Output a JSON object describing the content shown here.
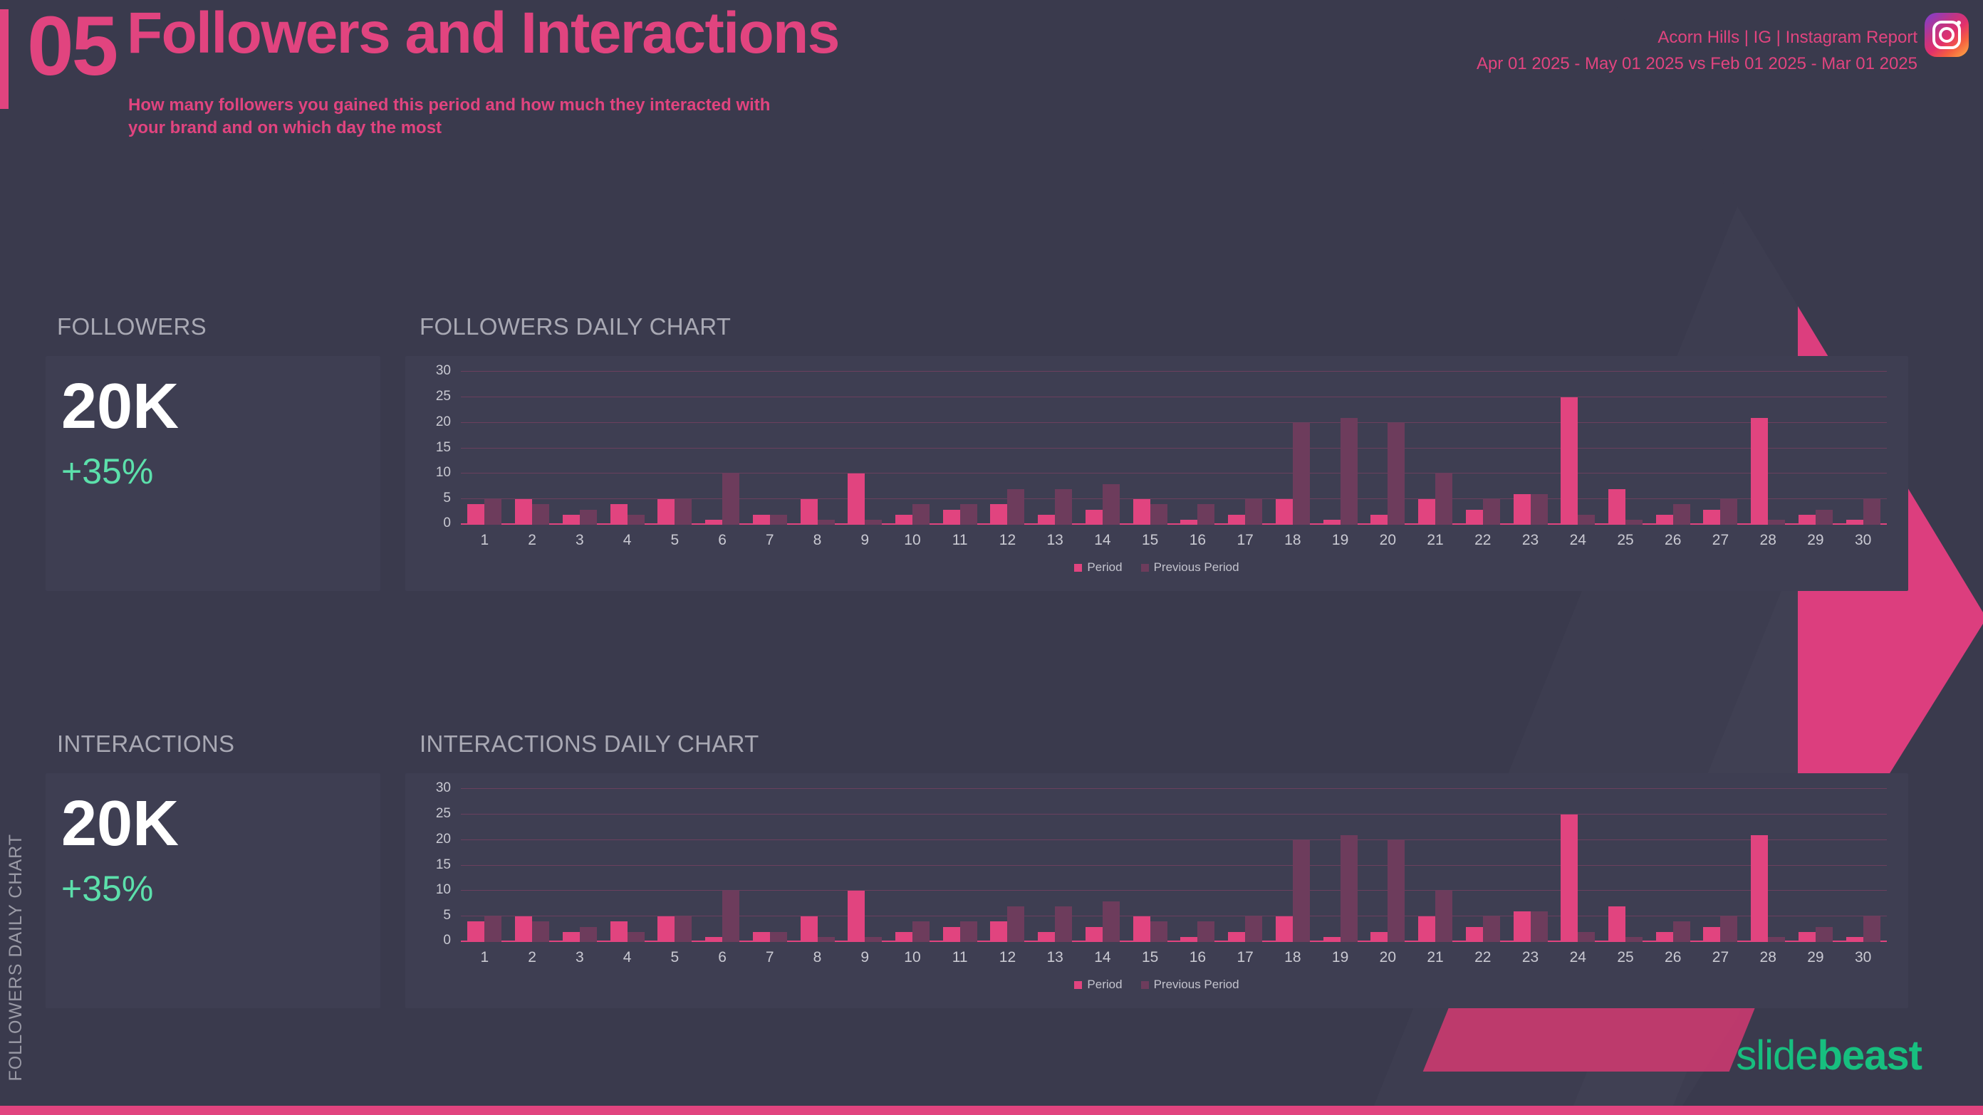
{
  "header": {
    "number": "05",
    "title": "Followers and Interactions",
    "subtitle": "How many followers you gained this period and how much they interacted with your brand and on which day the most",
    "account_line": "Acorn Hills | IG | Instagram Report",
    "date_range_line": "Apr 01 2025 - May 01 2025 vs Feb 01 2025 - Mar 01 2025",
    "platform_icon": "instagram-icon"
  },
  "colors": {
    "accent_pink": "#E1447F",
    "prev_period": "#6D3C5C",
    "positive_green": "#5CE0AB",
    "card_bg": "#3E3E52",
    "page_bg": "#3A3A4D"
  },
  "kpis": [
    {
      "title": "FOLLOWERS",
      "value": "20K",
      "delta": "+35%"
    },
    {
      "title": "INTERACTIONS",
      "value": "20K",
      "delta": "+35%"
    }
  ],
  "side_label": "FOLLOWERS DAILY CHART",
  "logo": {
    "light": "slide",
    "bold": "beast"
  },
  "chart_data": [
    {
      "type": "bar",
      "title": "FOLLOWERS DAILY CHART",
      "xlabel": "",
      "ylabel": "",
      "ylim": [
        0,
        30
      ],
      "yticks": [
        0,
        5,
        10,
        15,
        20,
        25,
        30
      ],
      "grid": true,
      "legend_position": "bottom",
      "categories": [
        "1",
        "2",
        "3",
        "4",
        "5",
        "6",
        "7",
        "8",
        "9",
        "10",
        "11",
        "12",
        "13",
        "14",
        "15",
        "16",
        "17",
        "18",
        "19",
        "20",
        "21",
        "22",
        "23",
        "24",
        "25",
        "26",
        "27",
        "28",
        "29",
        "30"
      ],
      "series": [
        {
          "name": "Period",
          "values": [
            4,
            5,
            2,
            4,
            5,
            1,
            2,
            5,
            10,
            2,
            3,
            4,
            2,
            3,
            5,
            1,
            2,
            5,
            1,
            2,
            5,
            3,
            6,
            25,
            7,
            2,
            3,
            21,
            2,
            1
          ]
        },
        {
          "name": "Previous Period",
          "values": [
            5,
            4,
            3,
            2,
            5,
            10,
            2,
            1,
            1,
            4,
            4,
            7,
            7,
            8,
            4,
            4,
            5,
            20,
            21,
            20,
            10,
            5,
            6,
            2,
            1,
            4,
            5,
            1,
            3,
            5
          ]
        }
      ]
    },
    {
      "type": "bar",
      "title": "INTERACTIONS DAILY CHART",
      "xlabel": "",
      "ylabel": "",
      "ylim": [
        0,
        30
      ],
      "yticks": [
        0,
        5,
        10,
        15,
        20,
        25,
        30
      ],
      "grid": true,
      "legend_position": "bottom",
      "categories": [
        "1",
        "2",
        "3",
        "4",
        "5",
        "6",
        "7",
        "8",
        "9",
        "10",
        "11",
        "12",
        "13",
        "14",
        "15",
        "16",
        "17",
        "18",
        "19",
        "20",
        "21",
        "22",
        "23",
        "24",
        "25",
        "26",
        "27",
        "28",
        "29",
        "30"
      ],
      "series": [
        {
          "name": "Period",
          "values": [
            4,
            5,
            2,
            4,
            5,
            1,
            2,
            5,
            10,
            2,
            3,
            4,
            2,
            3,
            5,
            1,
            2,
            5,
            1,
            2,
            5,
            3,
            6,
            25,
            7,
            2,
            3,
            21,
            2,
            1
          ]
        },
        {
          "name": "Previous Period",
          "values": [
            5,
            4,
            3,
            2,
            5,
            10,
            2,
            1,
            1,
            4,
            4,
            7,
            7,
            8,
            4,
            4,
            5,
            20,
            21,
            20,
            10,
            5,
            6,
            2,
            1,
            4,
            5,
            1,
            3,
            5
          ]
        }
      ]
    }
  ]
}
